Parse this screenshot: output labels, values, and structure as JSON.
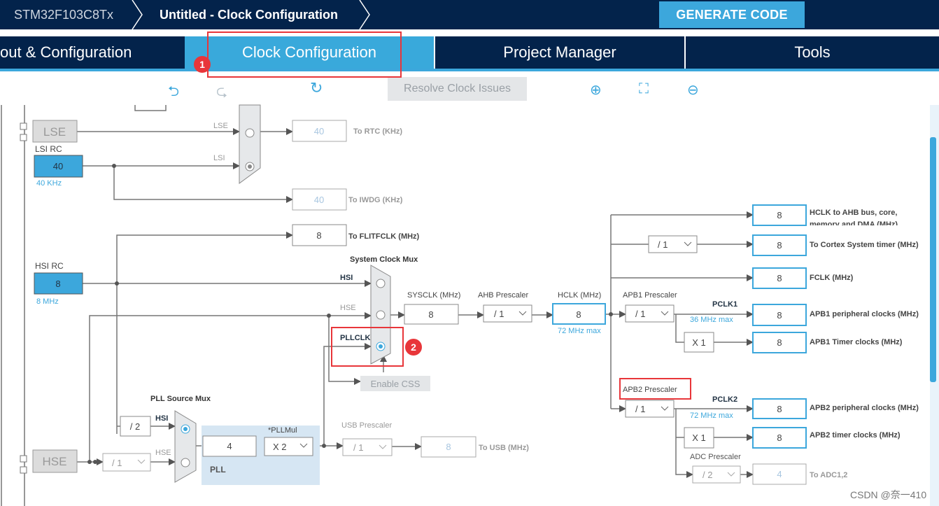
{
  "header": {
    "breadcrumb": [
      "STM32F103C8Tx",
      "Untitled - Clock Configuration"
    ],
    "generate_label": "GENERATE CODE"
  },
  "tabs": [
    {
      "label": "out & Configuration"
    },
    {
      "label": "Clock Configuration",
      "active": true
    },
    {
      "label": "Project Manager"
    },
    {
      "label": "Tools"
    }
  ],
  "toolbar": {
    "resolve_label": "Resolve Clock Issues",
    "icons": [
      "undo-icon",
      "redo-icon",
      "reset-icon",
      "zoom-in-icon",
      "fit-icon",
      "zoom-out-icon"
    ]
  },
  "annotations": {
    "badge1": "1",
    "badge2": "2"
  },
  "colors": {
    "navy": "#03234b",
    "accent": "#3ca7dc",
    "highlight": "#e8363a"
  },
  "diagram": {
    "lse": "LSE",
    "lsi_label": "LSI RC",
    "lsi_value": "40",
    "lsi_freq": "40 KHz",
    "rtc_in_lse": "LSE",
    "rtc_in_lsi": "LSI",
    "rtc_value": "40",
    "rtc_label": "To RTC (KHz)",
    "iwdg_value": "40",
    "iwdg_label": "To IWDG (KHz)",
    "flit_value": "8",
    "flit_label": "To FLITFCLK (MHz)",
    "hsi_label": "HSI RC",
    "hsi_value": "8",
    "hsi_freq": "8 MHz",
    "sysmux_label": "System Clock Mux",
    "sysmux_hsi": "HSI",
    "sysmux_hse": "HSE",
    "sysmux_pll": "PLLCLK",
    "enable_css": "Enable CSS",
    "sysclk_label": "SYSCLK (MHz)",
    "sysclk_value": "8",
    "ahb_label": "AHB Prescaler",
    "ahb_value": "/ 1",
    "hclk_label": "HCLK (MHz)",
    "hclk_value": "8",
    "hclk_max": "72 MHz max",
    "ahb_out_value": "8",
    "ahb_out_label1": "HCLK to AHB bus, core,",
    "ahb_out_label2": "memory and DMA (MHz)",
    "cortex_div": "/ 1",
    "cortex_value": "8",
    "cortex_label": "To Cortex System timer (MHz)",
    "fclk_value": "8",
    "fclk_label": "FCLK (MHz)",
    "apb1_label": "APB1 Prescaler",
    "apb1_value": "/ 1",
    "pclk1": "PCLK1",
    "pclk1_max": "36 MHz max",
    "apb1_periph_value": "8",
    "apb1_periph_label": "APB1 peripheral clocks (MHz)",
    "apb1_timer_mult": "X 1",
    "apb1_timer_value": "8",
    "apb1_timer_label": "APB1 Timer clocks (MHz)",
    "apb2_label": "APB2 Prescaler",
    "apb2_value": "/ 1",
    "pclk2": "PCLK2",
    "pclk2_max": "72 MHz max",
    "apb2_periph_value": "8",
    "apb2_periph_label": "APB2 peripheral clocks (MHz)",
    "apb2_timer_mult": "X 1",
    "apb2_timer_value": "8",
    "apb2_timer_label": "APB2 timer clocks (MHz)",
    "adc_label": "ADC Prescaler",
    "adc_value": "/ 2",
    "adc_out": "4",
    "adc_out_label": "To ADC1,2",
    "pllsrc_label": "PLL Source Mux",
    "pllsrc_hsi": "HSI",
    "pllsrc_hse": "HSE",
    "hsi_div": "/ 2",
    "hse": "HSE",
    "hse_div": "/ 1",
    "pll_value": "4",
    "pllmul_label": "*PLLMul",
    "pllmul_value": "X 2",
    "pll_label": "PLL",
    "usb_label": "USB Prescaler",
    "usb_value": "/ 1",
    "usb_out": "8",
    "usb_out_label": "To USB (MHz)"
  },
  "watermark": "CSDN @奈一410"
}
